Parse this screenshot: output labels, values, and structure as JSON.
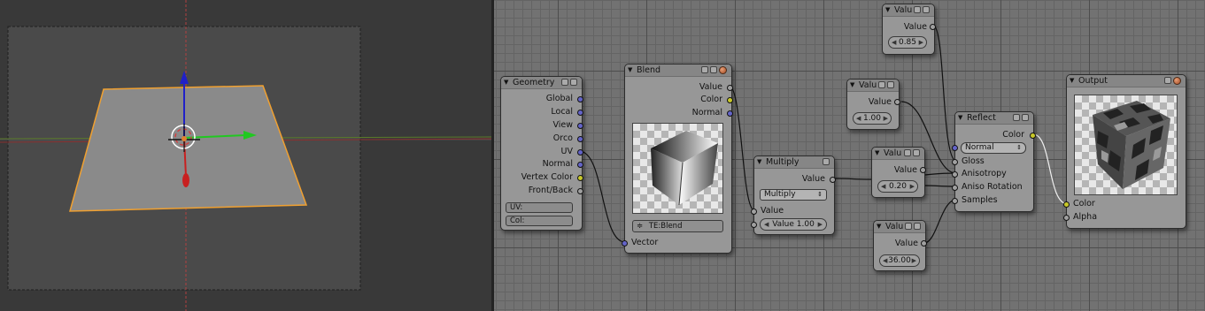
{
  "viewport": {
    "colors": {
      "plane_fill": "#8a8a8a",
      "plane_outline": "#f0a030",
      "x_axis": "#a33535",
      "y_axis": "#6e9a2a",
      "z_arrow": "#2020c8",
      "y_arrow": "#20c820",
      "x_arrow": "#c82020"
    }
  },
  "nodes": {
    "geometry": {
      "title": "Geometry",
      "outputs": [
        "Global",
        "Local",
        "View",
        "Orco",
        "UV",
        "Normal",
        "Vertex Color",
        "Front/Back"
      ],
      "uv_field": "UV:",
      "col_field": "Col:"
    },
    "blend": {
      "title": "Blend",
      "outputs": [
        "Value",
        "Color",
        "Normal"
      ],
      "texture": "TE:Blend",
      "input": "Vector"
    },
    "multiply": {
      "title": "Multiply",
      "output": "Value",
      "operation": "Multiply",
      "input1": "Value",
      "input2": "Value 1.00"
    },
    "value1": {
      "title": "Valu",
      "output": "Value",
      "value": "0.85"
    },
    "value2": {
      "title": "Valu",
      "output": "Value",
      "value": "1.00"
    },
    "value3": {
      "title": "Valu",
      "output": "Value",
      "value": "0.20"
    },
    "value4": {
      "title": "Valu",
      "output": "Value",
      "value": "36.00"
    },
    "reflect": {
      "title": "Reflect",
      "output": "Color",
      "inputs": [
        "Normal",
        "Gloss",
        "Anisotropy",
        "Aniso Rotation",
        "Samples"
      ]
    },
    "output": {
      "title": "Output",
      "inputs": [
        "Color",
        "Alpha"
      ]
    }
  },
  "socket_colors": {
    "vector": "#6464c8",
    "color": "#c8c829",
    "value": "#a0a0a0"
  }
}
